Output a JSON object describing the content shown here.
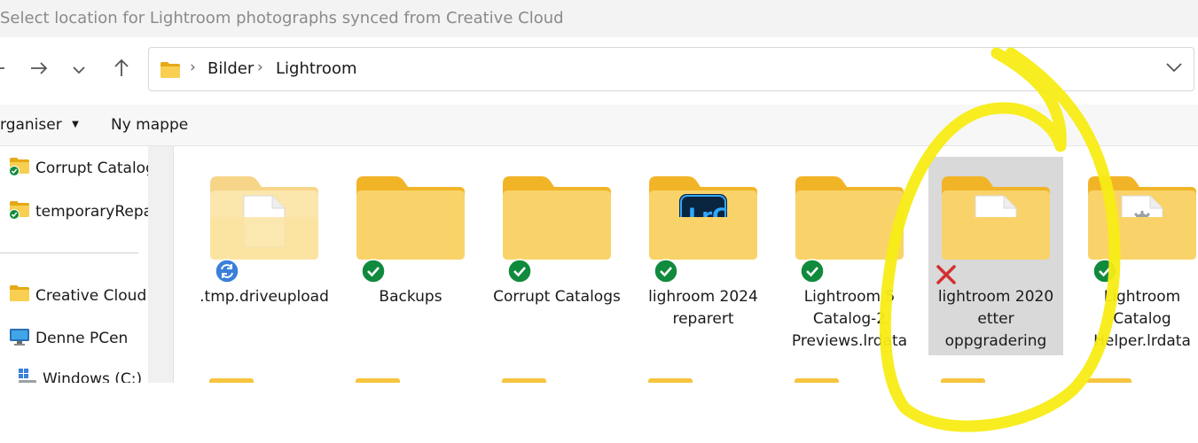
{
  "title": "Select location for Lightroom photographs synced from Creative Cloud",
  "nav": {
    "back_icon": "arrow-left-icon",
    "forward_icon": "arrow-right-icon",
    "recent_icon": "chevron-down-icon",
    "up_icon": "arrow-up-icon"
  },
  "address": {
    "crumbs": [
      "Bilder",
      "Lightroom"
    ]
  },
  "commands": {
    "organise": "rganiser",
    "new_folder": "Ny mappe"
  },
  "sidebar": {
    "items": [
      {
        "label": "Corrupt Catalog",
        "icon": "synced-folder-icon"
      },
      {
        "label": "temporaryRepair",
        "icon": "synced-folder-icon"
      },
      {
        "label": "Creative Cloud F",
        "icon": "folder-icon"
      },
      {
        "label": "Denne PCen",
        "icon": "computer-icon"
      },
      {
        "label": "Windows (C:)",
        "icon": "drive-icon"
      }
    ]
  },
  "files": [
    {
      "name": ".tmp.driveupload",
      "status": "syncing",
      "overlay": "document"
    },
    {
      "name": "Backups",
      "status": "synced",
      "overlay": "none"
    },
    {
      "name": "Corrupt Catalogs",
      "status": "synced",
      "overlay": "none"
    },
    {
      "name": "lighroom 2024 reparert",
      "status": "synced",
      "overlay": "lrc"
    },
    {
      "name": "Lightroom 5 Catalog-2 Previews.lrdata",
      "status": "synced",
      "overlay": "none"
    },
    {
      "name": "lightroom 2020 etter oppgradering",
      "status": "error",
      "overlay": "document",
      "selected": true
    },
    {
      "name": "Lightroom Catalog Helper.lrdata",
      "status": "synced",
      "overlay": "gear-document"
    }
  ],
  "colors": {
    "folder": "#f6c540",
    "synced": "#108a3c",
    "syncing": "#3a7fd9",
    "error": "#d32f2f",
    "annotation": "#f7ec15",
    "selection": "#d9d9d9"
  }
}
